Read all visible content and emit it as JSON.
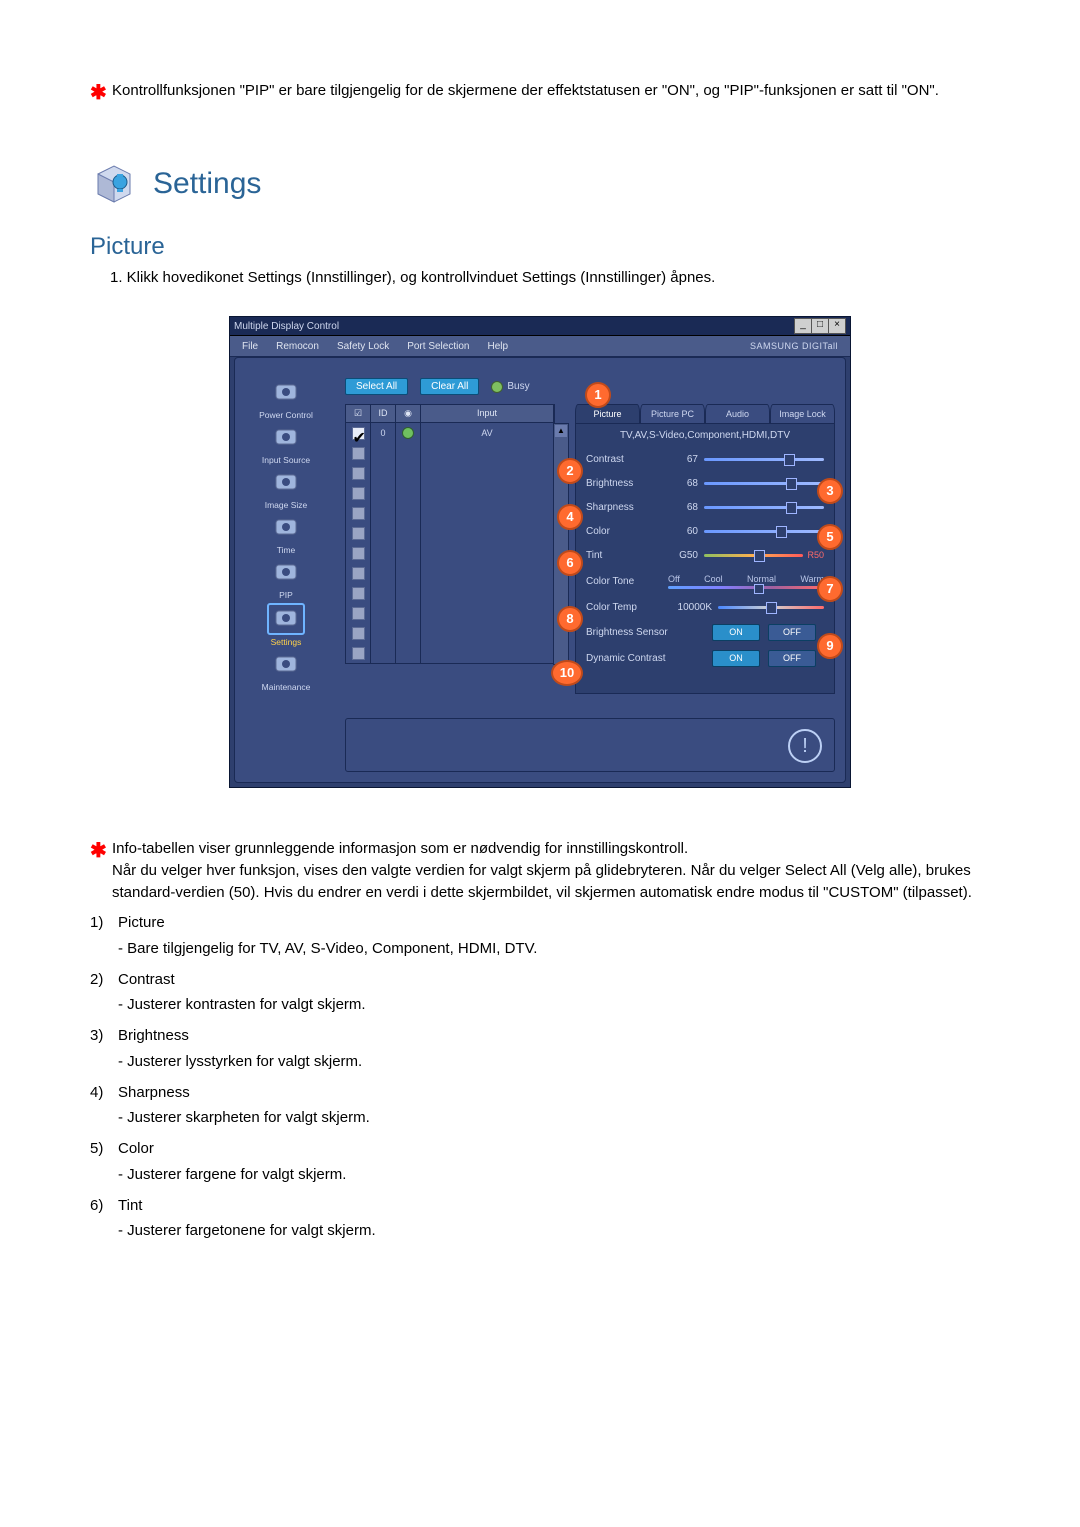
{
  "top_note": "Kontrollfunksjonen \"PIP\" er bare tilgjengelig for de skjermene der effektstatusen er \"ON\", og \"PIP\"-funksjonen er satt til \"ON\".",
  "heading": "Settings",
  "subheading": "Picture",
  "step1": "1. Klikk hovedikonet Settings (Innstillinger), og kontrollvinduet Settings (Innstillinger) åpnes.",
  "screenshot": {
    "title": "Multiple Display Control",
    "menu": [
      "File",
      "Remocon",
      "Safety Lock",
      "Port Selection",
      "Help"
    ],
    "brand": "SAMSUNG DIGITall",
    "sidebar": [
      {
        "label": "Power Control"
      },
      {
        "label": "Input Source"
      },
      {
        "label": "Image Size"
      },
      {
        "label": "Time"
      },
      {
        "label": "PIP"
      },
      {
        "label": "Settings",
        "selected": true
      },
      {
        "label": "Maintenance"
      }
    ],
    "toolbar": {
      "select_all": "Select All",
      "clear_all": "Clear All",
      "busy": "Busy"
    },
    "table": {
      "headers": [
        "",
        "ID",
        "",
        "Input"
      ],
      "checkbox_header_glyph": "☑",
      "status_header_glyph": "◉",
      "rows": [
        {
          "checked": true,
          "id": "0",
          "status": true,
          "input": "AV"
        },
        {
          "checked": false,
          "id": "",
          "status": false,
          "input": ""
        },
        {
          "checked": false,
          "id": "",
          "status": false,
          "input": ""
        },
        {
          "checked": false,
          "id": "",
          "status": false,
          "input": ""
        },
        {
          "checked": false,
          "id": "",
          "status": false,
          "input": ""
        },
        {
          "checked": false,
          "id": "",
          "status": false,
          "input": ""
        },
        {
          "checked": false,
          "id": "",
          "status": false,
          "input": ""
        },
        {
          "checked": false,
          "id": "",
          "status": false,
          "input": ""
        },
        {
          "checked": false,
          "id": "",
          "status": false,
          "input": ""
        },
        {
          "checked": false,
          "id": "",
          "status": false,
          "input": ""
        },
        {
          "checked": false,
          "id": "",
          "status": false,
          "input": ""
        },
        {
          "checked": false,
          "id": "",
          "status": false,
          "input": ""
        }
      ]
    },
    "tabs": [
      "Picture",
      "Picture PC",
      "Audio",
      "Image Lock"
    ],
    "panel_subtitle": "TV,AV,S-Video,Component,HDMI,DTV",
    "sliders": [
      {
        "label": "Contrast",
        "value": "67",
        "pct": 67
      },
      {
        "label": "Brightness",
        "value": "68",
        "pct": 68
      },
      {
        "label": "Sharpness",
        "value": "68",
        "pct": 68
      },
      {
        "label": "Color",
        "value": "60",
        "pct": 60
      }
    ],
    "tint": {
      "label": "Tint",
      "gvalue": "G50",
      "rvalue": "R50",
      "pct": 50
    },
    "color_tone": {
      "label": "Color Tone",
      "options": [
        "Off",
        "Cool",
        "Normal",
        "Warm"
      ],
      "pct": 55
    },
    "color_temp": {
      "label": "Color Temp",
      "value": "10000K",
      "pct": 45
    },
    "bright_sensor": {
      "label": "Brightness Sensor",
      "on": "ON",
      "off": "OFF"
    },
    "dyn_contrast": {
      "label": "Dynamic Contrast",
      "on": "ON",
      "off": "OFF"
    },
    "callouts": [
      "1",
      "2",
      "3",
      "4",
      "5",
      "6",
      "7",
      "8",
      "9",
      "10"
    ]
  },
  "bottom_note": "Info-tabellen viser grunnleggende informasjon som er nødvendig for innstillingskontroll.\nNår du velger hver funksjon, vises den valgte verdien for valgt skjerm på glidebryteren. Når du velger Select All (Velg alle), brukes standard-verdien (50). Hvis du endrer en verdi i dette skjermbildet, vil skjermen automatisk endre modus til \"CUSTOM\" (tilpasset).",
  "list": [
    {
      "n": "1)",
      "t": "Picture",
      "d": "- Bare tilgjengelig for TV, AV, S-Video, Component, HDMI, DTV."
    },
    {
      "n": "2)",
      "t": "Contrast",
      "d": "- Justerer kontrasten for valgt skjerm."
    },
    {
      "n": "3)",
      "t": "Brightness",
      "d": "- Justerer lysstyrken for valgt skjerm."
    },
    {
      "n": "4)",
      "t": "Sharpness",
      "d": "- Justerer skarpheten for valgt skjerm."
    },
    {
      "n": "5)",
      "t": "Color",
      "d": "- Justerer fargene for valgt skjerm."
    },
    {
      "n": "6)",
      "t": "Tint",
      "d": "- Justerer fargetonene for valgt skjerm."
    }
  ]
}
